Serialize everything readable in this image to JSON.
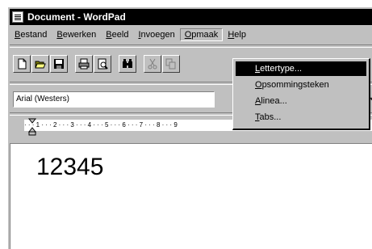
{
  "window": {
    "title": "Document - WordPad"
  },
  "menu": {
    "items": [
      "Bestand",
      "Bewerken",
      "Beeld",
      "Invoegen",
      "Opmaak",
      "Help"
    ]
  },
  "toolbar": {
    "icons": [
      "new-icon",
      "open-icon",
      "save-icon",
      "print-icon",
      "print-preview-icon",
      "find-icon",
      "cut-icon",
      "copy-icon"
    ]
  },
  "format": {
    "font": "Arial (Westers)"
  },
  "ruler": {
    "text": "· · · 1 · · · 2 · · · 3 · · · 4 · · · 5 · · · 6 · · · 7 · · · 8 · · · 9"
  },
  "document": {
    "text": "12345"
  },
  "dropdown": {
    "items": [
      "Lettertype...",
      "Opsommingsteken",
      "Alinea...",
      "Tabs..."
    ],
    "selected_index": 0
  }
}
